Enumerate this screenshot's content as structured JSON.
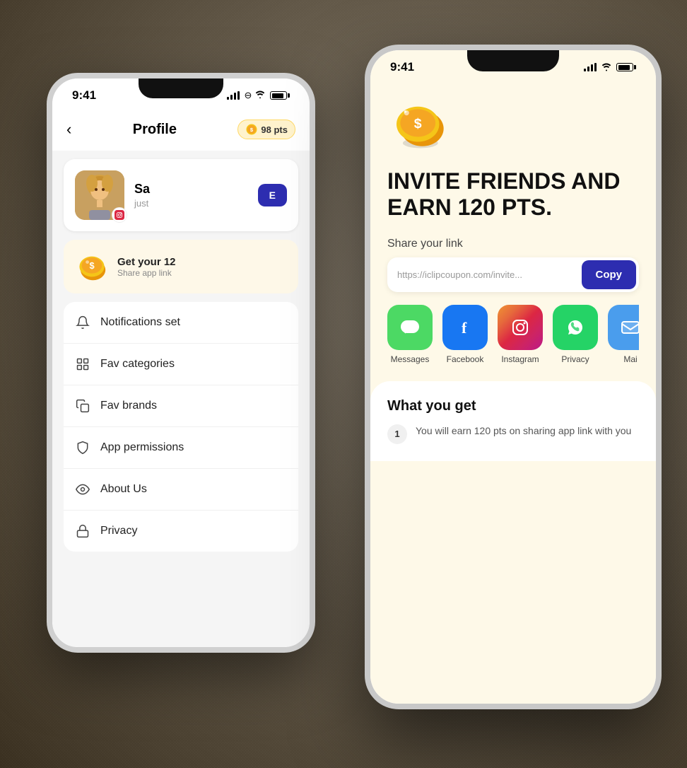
{
  "background": {
    "color": "#6b6b5a"
  },
  "phone_back": {
    "status_bar": {
      "time": "9:41"
    },
    "header": {
      "back_label": "‹",
      "title": "Profile",
      "pts_badge": "98 pts"
    },
    "profile_card": {
      "name": "Sa",
      "subtitle": "just",
      "edit_button": "E"
    },
    "referral_banner": {
      "title": "Get your 12",
      "subtitle": "Share app link"
    },
    "menu_items": [
      {
        "label": "Notifications set",
        "icon": "bell"
      },
      {
        "label": "Fav categories",
        "icon": "grid"
      },
      {
        "label": "Fav brands",
        "icon": "copy"
      },
      {
        "label": "App permissions",
        "icon": "shield"
      },
      {
        "label": "About Us",
        "icon": "eye"
      },
      {
        "label": "Privacy",
        "icon": "lock"
      }
    ]
  },
  "phone_front": {
    "status_bar": {
      "time": "9:41"
    },
    "invite": {
      "heading_line1": "INVITE FRIENDS AND",
      "heading_line2": "EARN 120 PTS.",
      "share_link_label": "Share your link",
      "share_link_url": "https://iclipcoupon.com/invite...",
      "copy_button_label": "Copy"
    },
    "social_apps": [
      {
        "name": "Messages",
        "icon": "💬",
        "class": "social-icon-messages"
      },
      {
        "name": "Facebook",
        "icon": "f",
        "class": "social-icon-facebook"
      },
      {
        "name": "Instagram",
        "icon": "📷",
        "class": "social-icon-instagram"
      },
      {
        "name": "WhatsApp",
        "icon": "📱",
        "class": "social-icon-whatsapp"
      },
      {
        "name": "Mail",
        "icon": "✉",
        "class": "social-icon-mail"
      }
    ],
    "what_you_get": {
      "title": "What you get",
      "reward_text": "You will earn 120 pts on sharing app link with you"
    }
  }
}
